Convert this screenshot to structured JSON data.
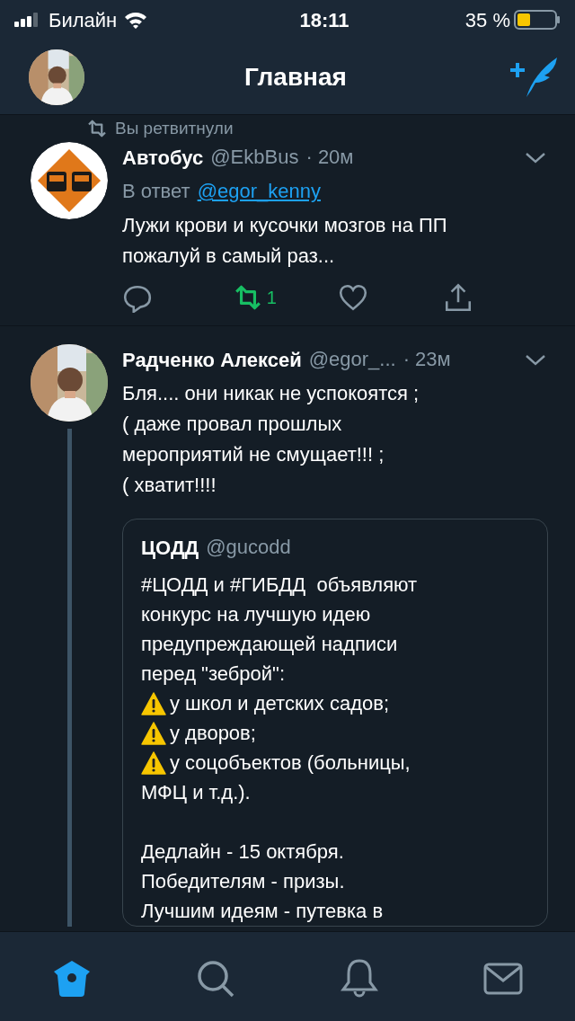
{
  "status_bar": {
    "carrier": "Билайн",
    "time": "18:11",
    "battery": "35 %"
  },
  "header": {
    "title": "Главная"
  },
  "tweets": [
    {
      "context": "Вы ретвитнули",
      "avatar": {
        "kind": "logo"
      },
      "name": "Автобус",
      "handle": "@EkbBus",
      "time": "· 20м",
      "reply_label": "В ответ",
      "reply_to": "@egor_kenny",
      "text": [
        "Лужи крови и кусочки мозгов на ПП",
        "пожалуй в самый раз..."
      ],
      "actions": {
        "retweeted": true,
        "retweet_count": "1",
        "liked": false
      },
      "thread": false
    },
    {
      "name": "Радченко Алексей",
      "handle": "@egor_...",
      "time": "· 23м",
      "text": [
        "Бля.... они никак не успокоятся ;",
        "( даже провал прошлых",
        "мероприятий не смущает!!! ;",
        "( хватит!!!!"
      ],
      "thread": true,
      "quote": {
        "name": "ЦОДД",
        "handle": "@gucodd",
        "lines": [
          {
            "kind": "text",
            "text": "#ЦОДД и #ГИБДД  объявляют"
          },
          {
            "kind": "text",
            "text": "конкурс на лучшую идею"
          },
          {
            "kind": "text",
            "text": "предупреждающей надписи"
          },
          {
            "kind": "text",
            "text": "перед \"зеброй\":"
          },
          {
            "kind": "warning",
            "text": "у школ и детских садов;"
          },
          {
            "kind": "warning",
            "text": "у дворов;"
          },
          {
            "kind": "warning",
            "text": "у соцобъектов (больницы,"
          },
          {
            "kind": "text",
            "text": "МФЦ и т.д.)."
          },
          {
            "kind": "blank"
          },
          {
            "kind": "text",
            "text": "Дедлайн - 15 октября."
          },
          {
            "kind": "text",
            "text": "Победителям - призы."
          },
          {
            "kind": "text",
            "text": "Лучшим идеям - путевка в"
          }
        ]
      }
    }
  ],
  "tab_bar": [
    {
      "kind": "home",
      "selected": true
    },
    {
      "kind": "search",
      "selected": false
    },
    {
      "kind": "notifications",
      "selected": false
    },
    {
      "kind": "messages",
      "selected": false
    }
  ]
}
